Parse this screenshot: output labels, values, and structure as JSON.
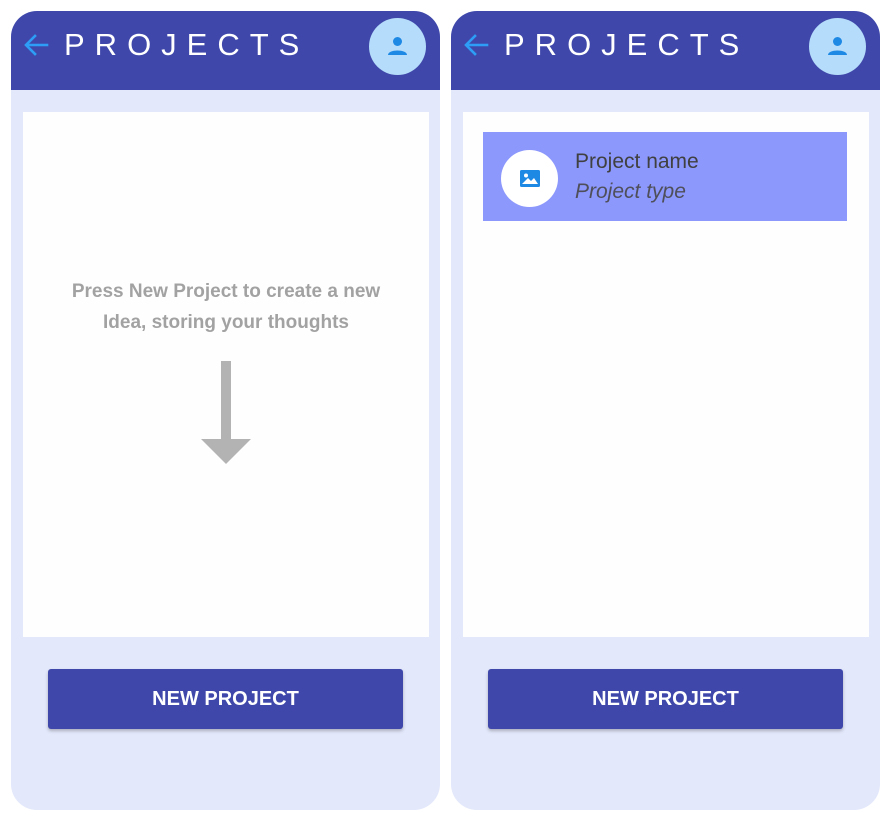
{
  "colors": {
    "appbar": "#3f48aa",
    "back_arrow": "#2d9df5",
    "avatar_bg": "#b5dcfa",
    "avatar_icon": "#1e88e5",
    "screen_bg": "#e3e8fb",
    "card_bg": "#fefefe",
    "project_item_bg": "#8c98fc",
    "button_bg": "#3f48aa",
    "hint_text": "#a2a2a2",
    "arrow": "#b3b3b3"
  },
  "screens": [
    {
      "appbar": {
        "title": "PROJECTS",
        "back_icon": "arrow-left-icon",
        "avatar_icon": "person-icon"
      },
      "empty_state": {
        "line1": "Press New Project to create a new",
        "line2": "Idea, storing your thoughts",
        "arrow_icon": "arrow-down-icon"
      },
      "new_project_label": "NEW PROJECT"
    },
    {
      "appbar": {
        "title": "PROJECTS",
        "back_icon": "arrow-left-icon",
        "avatar_icon": "person-icon"
      },
      "projects": [
        {
          "name": "Project name",
          "type": "Project type",
          "thumb_icon": "image-icon"
        }
      ],
      "new_project_label": "NEW PROJECT"
    }
  ]
}
